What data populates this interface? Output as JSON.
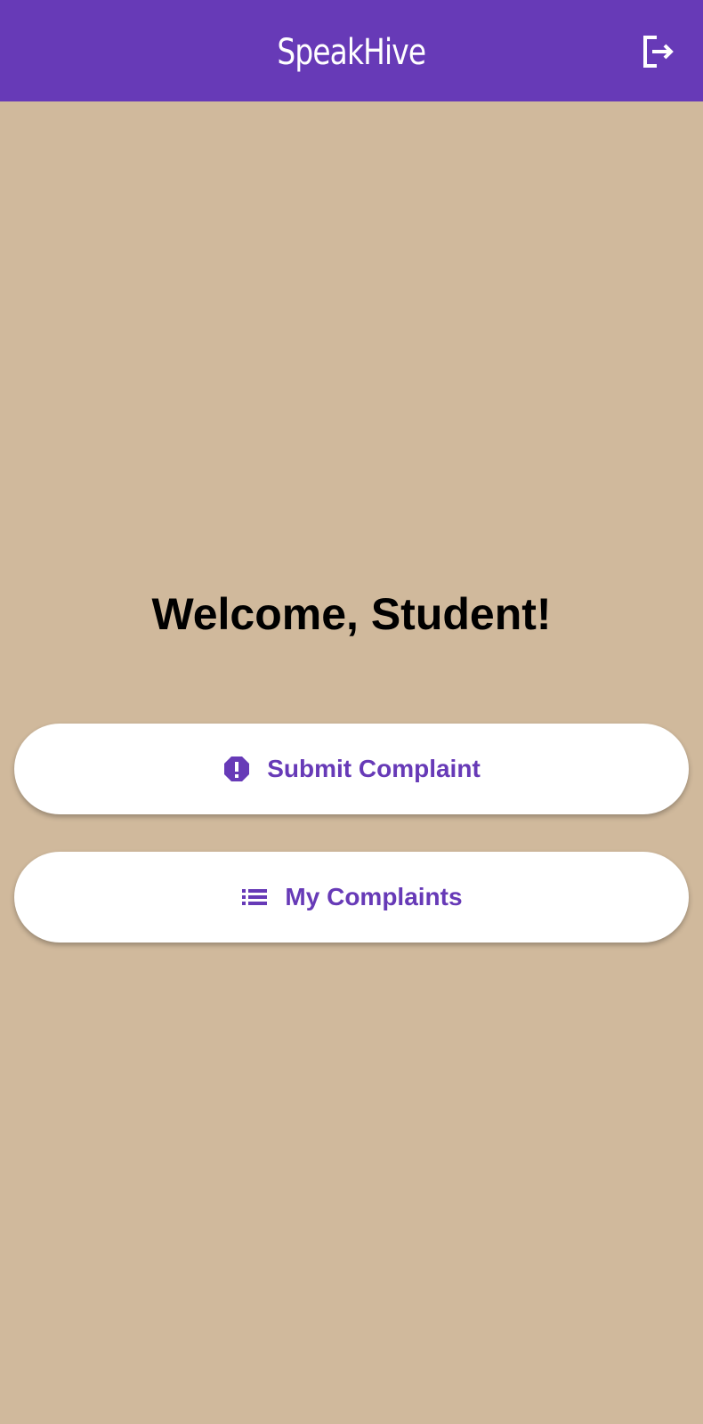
{
  "app_bar": {
    "title": "SpeakHive",
    "logout_icon": "logout-icon"
  },
  "main": {
    "welcome_text": "Welcome, Student!",
    "buttons": [
      {
        "label": "Submit Complaint",
        "icon": "report-icon"
      },
      {
        "label": "My Complaints",
        "icon": "list-icon"
      }
    ]
  },
  "colors": {
    "primary": "#673ab7",
    "background": "#d0b99c",
    "button_bg": "#ffffff",
    "text": "#000000"
  }
}
